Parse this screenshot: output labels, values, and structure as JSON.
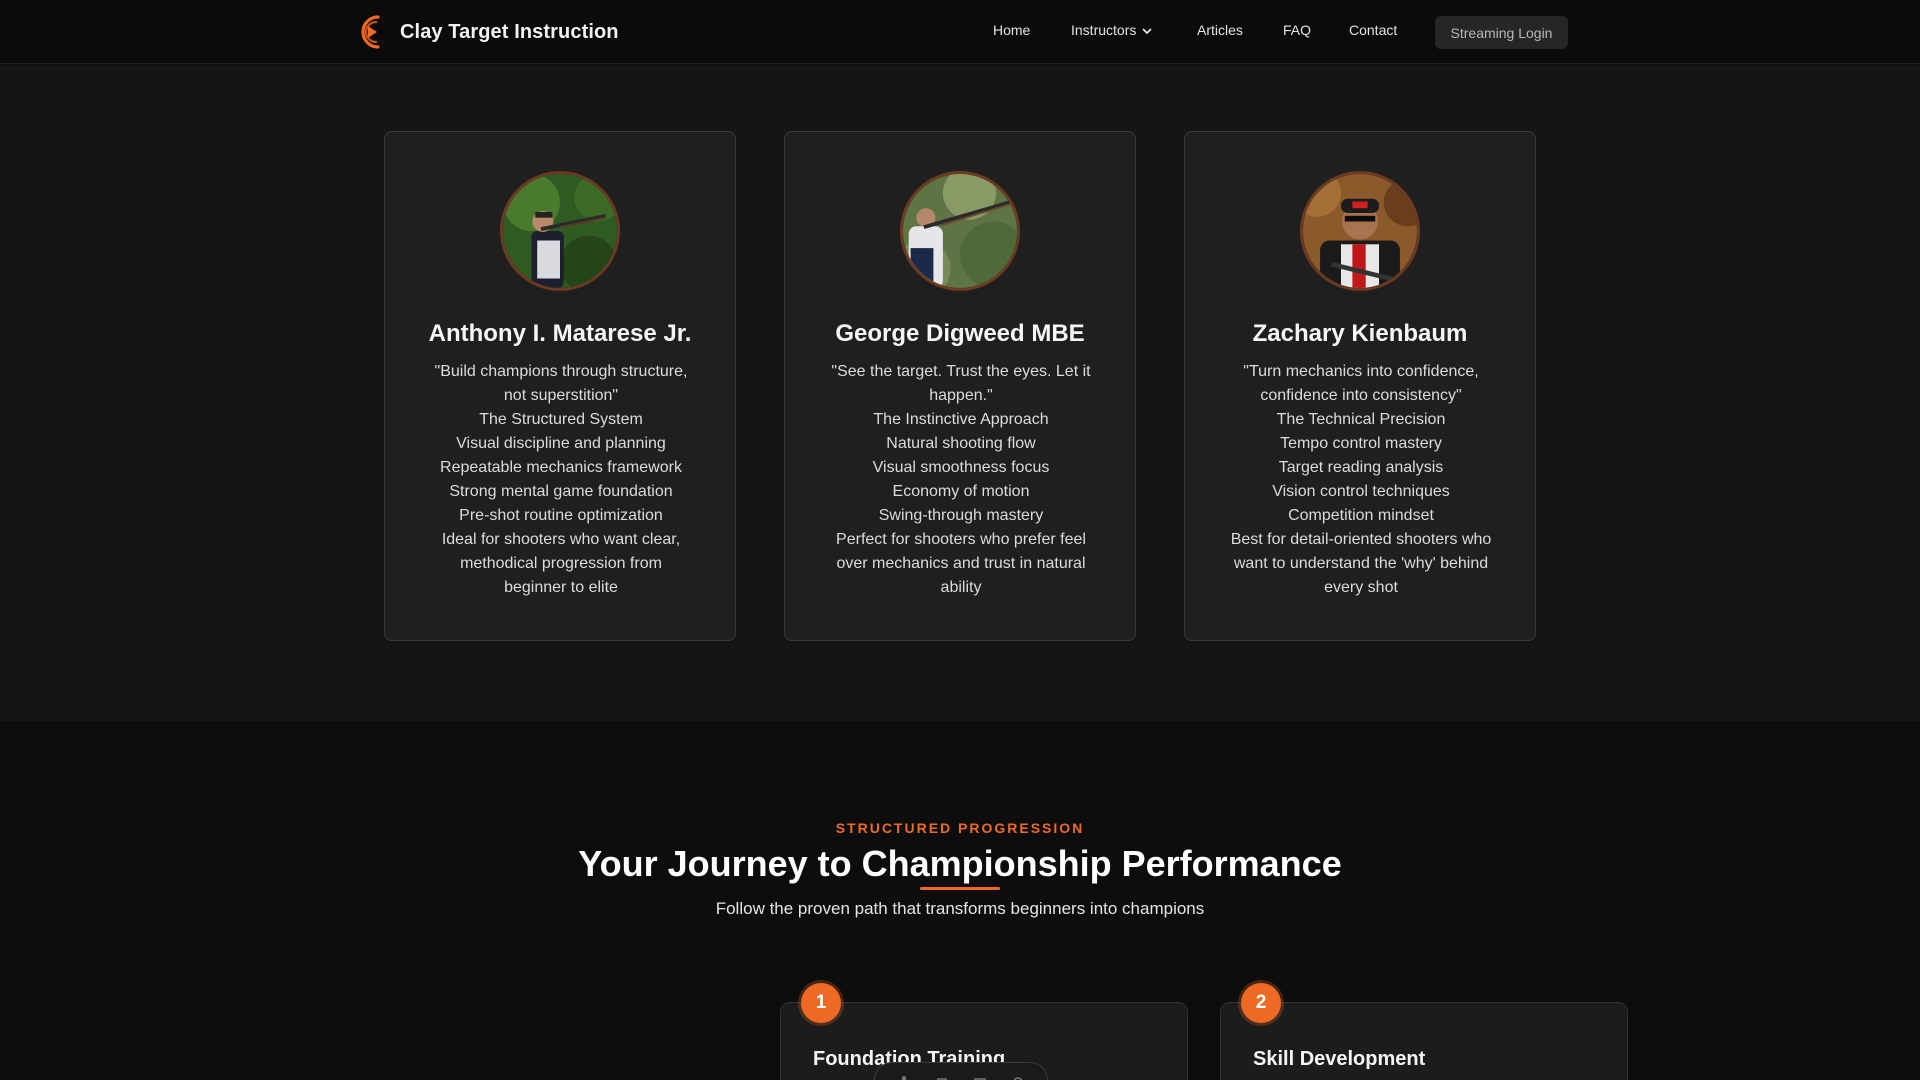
{
  "nav": {
    "brand": "Clay Target Instruction",
    "links": [
      "Home",
      "Instructors",
      "Articles",
      "FAQ",
      "Contact"
    ],
    "login": "Streaming Login"
  },
  "instructors": [
    {
      "name": "Anthony I. Matarese Jr.",
      "lines": [
        "\"Build champions through structure,",
        "not superstition\"",
        "The Structured System",
        "Visual discipline and planning",
        "Repeatable mechanics framework",
        "Strong mental game foundation",
        "Pre-shot routine optimization",
        "Ideal for shooters who want clear,",
        "methodical progression from",
        "beginner to elite"
      ]
    },
    {
      "name": "George Digweed MBE",
      "lines": [
        "\"See the target. Trust the eyes. Let it",
        "happen.\"",
        "The Instinctive Approach",
        "Natural shooting flow",
        "Visual smoothness focus",
        "Economy of motion",
        "Swing-through mastery",
        "Perfect for shooters who prefer feel",
        "over mechanics and trust in natural",
        "ability"
      ]
    },
    {
      "name": "Zachary Kienbaum",
      "lines": [
        "\"Turn mechanics into confidence,",
        "confidence into consistency\"",
        "The Technical Precision",
        "Tempo control mastery",
        "Target reading analysis",
        "Vision control techniques",
        "Competition mindset",
        "Best for detail-oriented shooters who",
        "want to understand the 'why' behind",
        "every shot"
      ]
    }
  ],
  "journey": {
    "eyebrow": "STRUCTURED PROGRESSION",
    "title": "Your Journey to Championship Performance",
    "subtitle": "Follow the proven path that transforms beginners into champions",
    "steps": [
      {
        "num": "1",
        "title": "Foundation Training"
      },
      {
        "num": "2",
        "title": "Skill Development"
      }
    ]
  },
  "colors": {
    "accent": "#ee6a24",
    "background": "#141414",
    "card": "#1f1f1f"
  }
}
